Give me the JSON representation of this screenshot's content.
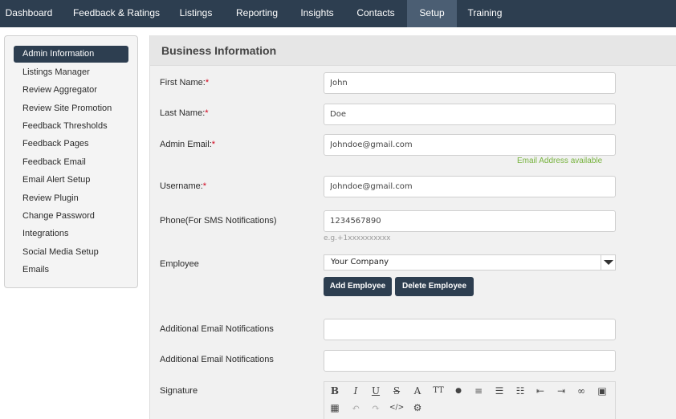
{
  "topnav": {
    "tabs": [
      {
        "label": "Dashboard"
      },
      {
        "label": "Feedback & Ratings"
      },
      {
        "label": "Listings"
      },
      {
        "label": "Reporting"
      },
      {
        "label": "Insights"
      },
      {
        "label": "Contacts"
      },
      {
        "label": "Setup",
        "active": true
      },
      {
        "label": "Training"
      }
    ]
  },
  "sidebar": {
    "items": [
      {
        "label": "Admin Information",
        "active": true
      },
      {
        "label": "Listings Manager"
      },
      {
        "label": "Review Aggregator"
      },
      {
        "label": "Review Site Promotion"
      },
      {
        "label": "Feedback Thresholds"
      },
      {
        "label": "Feedback Pages"
      },
      {
        "label": "Feedback Email"
      },
      {
        "label": "Email Alert Setup"
      },
      {
        "label": "Review Plugin"
      },
      {
        "label": "Change Password"
      },
      {
        "label": "Integrations"
      },
      {
        "label": "Social Media Setup"
      },
      {
        "label": "Emails"
      }
    ]
  },
  "form": {
    "title": "Business Information",
    "first_name": {
      "label": "First Name:",
      "required": "*",
      "value": "John"
    },
    "last_name": {
      "label": "Last Name:",
      "required": "*",
      "value": "Doe"
    },
    "admin_email": {
      "label": "Admin Email:",
      "required": "*",
      "value": "Johndoe@gmail.com",
      "status": "Email Address available"
    },
    "username": {
      "label": "Username:",
      "required": "*",
      "value": "Johndoe@gmail.com"
    },
    "phone": {
      "label": "Phone(For SMS Notifications)",
      "value": "1234567890",
      "hint": "e.g.+1xxxxxxxxxx"
    },
    "employee": {
      "label": "Employee",
      "selected": "Your Company"
    },
    "add_employee_label": "Add Employee",
    "delete_employee_label": "Delete Employee",
    "additional_email_1": {
      "label": "Additional Email Notifications",
      "value": ""
    },
    "additional_email_2": {
      "label": "Additional Email Notifications",
      "value": ""
    },
    "signature": {
      "label": "Signature"
    }
  },
  "colors": {
    "nav_bg": "#2d3e50",
    "nav_active": "#4b5e73",
    "required": "#d0021b",
    "success": "#78b33f"
  },
  "editor_tools": [
    {
      "glyph": "B",
      "name": "bold-icon"
    },
    {
      "glyph": "I",
      "name": "italic-icon"
    },
    {
      "glyph": "U",
      "name": "underline-icon"
    },
    {
      "glyph": "S",
      "name": "strikethrough-icon"
    },
    {
      "glyph": "A",
      "name": "font-color-icon"
    },
    {
      "glyph": "TT",
      "name": "font-size-icon"
    },
    {
      "glyph": "●",
      "name": "color-drop-icon"
    },
    {
      "glyph": "≡",
      "name": "align-icon"
    },
    {
      "glyph": "☰",
      "name": "ordered-list-icon"
    },
    {
      "glyph": "☷",
      "name": "unordered-list-icon"
    },
    {
      "glyph": "⇤",
      "name": "outdent-icon"
    },
    {
      "glyph": "⇥",
      "name": "indent-icon"
    },
    {
      "glyph": "∞",
      "name": "link-icon"
    },
    {
      "glyph": "▣",
      "name": "image-icon"
    },
    {
      "glyph": "▦",
      "name": "table-icon"
    },
    {
      "glyph": "↶",
      "name": "undo-icon"
    },
    {
      "glyph": "↷",
      "name": "redo-icon"
    },
    {
      "glyph": "</>",
      "name": "code-view-icon"
    },
    {
      "glyph": "⚙",
      "name": "settings-icon"
    }
  ]
}
